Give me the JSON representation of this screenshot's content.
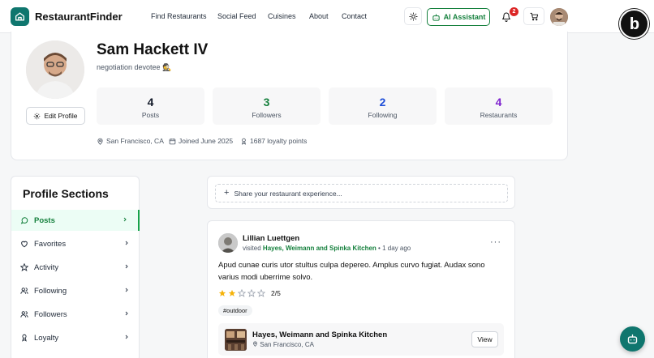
{
  "header": {
    "brand": "RestaurantFinder",
    "nav": [
      "Find Restaurants",
      "Social Feed",
      "Cuisines",
      "About",
      "Contact"
    ],
    "ai_label": "AI Assistant",
    "notification_count": "2",
    "accent": "#15803d"
  },
  "profile": {
    "name": "Sam Hackett IV",
    "bio": "negotiation devotee 🕵",
    "edit_label": "Edit Profile",
    "stats": [
      {
        "value": "4",
        "label": "Posts",
        "color": "#111827"
      },
      {
        "value": "3",
        "label": "Followers",
        "color": "#15803d"
      },
      {
        "value": "2",
        "label": "Following",
        "color": "#1d4ed8"
      },
      {
        "value": "4",
        "label": "Restaurants",
        "color": "#7e22ce"
      }
    ],
    "location": "San Francisco, CA",
    "joined": "Joined June 2025",
    "loyalty": "1687 loyalty points"
  },
  "sidebar": {
    "title": "Profile Sections",
    "items": [
      {
        "label": "Posts",
        "icon": "comment-icon"
      },
      {
        "label": "Favorites",
        "icon": "heart-icon"
      },
      {
        "label": "Activity",
        "icon": "star-icon"
      },
      {
        "label": "Following",
        "icon": "users-icon"
      },
      {
        "label": "Followers",
        "icon": "users-icon"
      },
      {
        "label": "Loyalty",
        "icon": "award-icon"
      }
    ]
  },
  "composer": {
    "placeholder": "Share your restaurant experience..."
  },
  "post": {
    "author": "Lillian Luettgen",
    "action": "visited",
    "place": "Hayes, Weimann and Spinka Kitchen",
    "time": "1 day ago",
    "text": "Apud cunae curis utor stultus culpa depereo. Amplus curvo fugiat. Audax sono varius modi uberrime solvo.",
    "rating": 2,
    "rating_max": 5,
    "rating_text": "2/5",
    "tag": "#outdoor",
    "restaurant": {
      "name": "Hayes, Weimann and Spinka Kitchen",
      "location": "San Francisco, CA",
      "view_label": "View"
    }
  }
}
